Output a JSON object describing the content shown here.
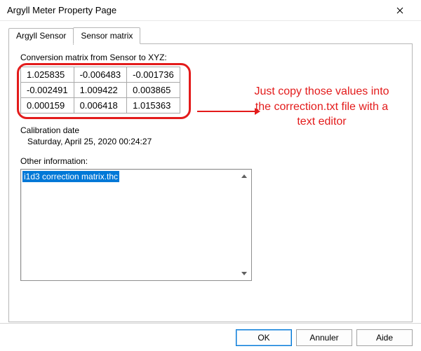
{
  "window": {
    "title": "Argyll Meter Property Page"
  },
  "tabs": {
    "sensor": "Argyll Sensor",
    "matrix": "Sensor matrix"
  },
  "labels": {
    "conversion": "Conversion matrix from Sensor to XYZ:",
    "calibration": "Calibration date",
    "other": "Other information:"
  },
  "matrix": {
    "r0c0": "1.025835",
    "r0c1": "-0.006483",
    "r0c2": "-0.001736",
    "r1c0": "-0.002491",
    "r1c1": "1.009422",
    "r1c2": "0.003865",
    "r2c0": "0.000159",
    "r2c1": "0.006418",
    "r2c2": "1.015363"
  },
  "calibration": {
    "value": "Saturday, April 25, 2020 00:24:27"
  },
  "other": {
    "line1": "i1d3 correction matrix.thc"
  },
  "annotation": {
    "text": "Just copy those values into the correction.txt file with a text editor"
  },
  "buttons": {
    "ok": "OK",
    "cancel": "Annuler",
    "help": "Aide"
  }
}
